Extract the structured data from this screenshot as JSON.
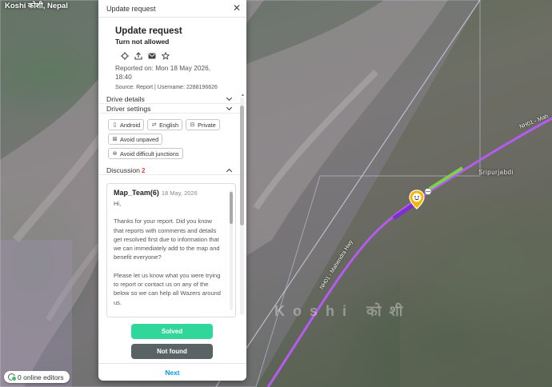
{
  "map": {
    "location_label": "Koshi कोशी, Nepal",
    "place_label": "Sripurjabdi",
    "region_label": "Koshi कोशी",
    "road_label_1": "NH01 - Mahendra Hwy",
    "road_label_2": "NH01 - Mah",
    "editors_label": "0 online editors",
    "colors": {
      "road": "#b45cf0",
      "segment": "#7bd24a",
      "pin": "#f7b500"
    }
  },
  "panel": {
    "header_title": "Update request",
    "close_icon": "close-icon",
    "request": {
      "title": "Update request",
      "subtitle": "Turn not allowed",
      "icons": [
        "crosshair-icon",
        "share-icon",
        "mail-icon",
        "star-icon"
      ],
      "reported_on": "Reported on: Mon 18 May 2026, 18:40",
      "source_line": "Source: Report | Username: 2288196626"
    },
    "sections": {
      "drive_details": "Drive details",
      "driver_settings": "Driver settings",
      "discussion": "Discussion",
      "discussion_count": "2"
    },
    "chips": [
      "Android",
      "English",
      "Private",
      "Avoid unpaved",
      "Avoid difficult junctions"
    ],
    "comment": {
      "author": "Map_Team(6)",
      "date": "18 May, 2026",
      "greeting": "Hi,",
      "para1": "Thanks for your report. Did you know that reports with comments and details get resolved first due to information that we can immediately add to the map and benefit everyone?",
      "para2": "Please let us know what you were trying to report or contact us on any of the below so we can help all Wazers around us."
    },
    "buttons": {
      "solved": "Solved",
      "not_found": "Not found",
      "next": "Next"
    },
    "colors": {
      "solved": "#31d79a",
      "not_found": "#596264",
      "next": "#0099ff",
      "count": "#e2403d"
    }
  }
}
